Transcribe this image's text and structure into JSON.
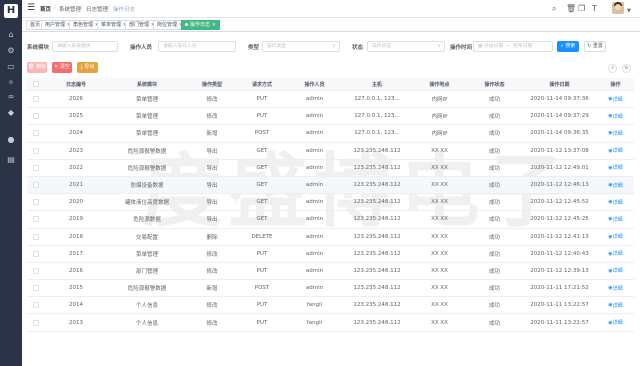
{
  "sidebar": {
    "logo": "H",
    "icons": [
      "home-icon",
      "settings-icon",
      "monitor-icon",
      "tool-icon",
      "link-icon",
      "shield-icon",
      "info-icon",
      "document-icon"
    ]
  },
  "breadcrumb": [
    "首页",
    "系统管理",
    "日志管理",
    "操作日志"
  ],
  "tags": [
    {
      "label": "首页"
    },
    {
      "label": "用户管理"
    },
    {
      "label": "角色管理"
    },
    {
      "label": "菜单管理"
    },
    {
      "label": "部门管理"
    },
    {
      "label": "岗位管理"
    },
    {
      "label": "操作日志"
    }
  ],
  "filters": {
    "module_label": "系统模块",
    "module_placeholder": "请输入系统模块",
    "operator_label": "操作人员",
    "operator_placeholder": "请输入操作人员",
    "type_label": "类型",
    "type_placeholder": "操作类型",
    "status_label": "状态",
    "status_placeholder": "操作状态",
    "time_label": "操作时间",
    "start_placeholder": "开始日期",
    "range_sep": "-",
    "end_placeholder": "结束日期",
    "search_label": "搜索",
    "reset_label": "重置"
  },
  "toolbar": {
    "delete_label": "删除",
    "clear_label": "清空",
    "export_label": "导出"
  },
  "table": {
    "headers": [
      "日志编号",
      "系统模块",
      "操作类型",
      "请求方式",
      "操作人员",
      "主机",
      "操作地点",
      "操作状态",
      "操作日期",
      "操作"
    ],
    "rows": [
      {
        "id": "2026",
        "module": "菜单管理",
        "type": "修改",
        "method": "PUT",
        "user": "admin",
        "host": "127.0.0.1, 123...",
        "location": "内网IP",
        "status": "成功",
        "date": "2020-11-14 09:37:36",
        "action": "详细"
      },
      {
        "id": "2025",
        "module": "菜单管理",
        "type": "修改",
        "method": "PUT",
        "user": "admin",
        "host": "127.0.0.1, 123...",
        "location": "内网IP",
        "status": "成功",
        "date": "2020-11-14 09:37:29",
        "action": "详细"
      },
      {
        "id": "2024",
        "module": "菜单管理",
        "type": "新增",
        "method": "POST",
        "user": "admin",
        "host": "127.0.0.1, 123...",
        "location": "内网IP",
        "status": "成功",
        "date": "2020-11-14 09:36:35",
        "action": "详细"
      },
      {
        "id": "2023",
        "module": "危险源报警数据",
        "type": "导出",
        "method": "GET",
        "user": "admin",
        "host": "123.235.248.112",
        "location": "XX XX",
        "status": "成功",
        "date": "2020-11-12 13:37:08",
        "action": "详细"
      },
      {
        "id": "2022",
        "module": "危险源报警数据",
        "type": "导出",
        "method": "GET",
        "user": "admin",
        "host": "123.235.248.112",
        "location": "XX XX",
        "status": "成功",
        "date": "2020-11-12 12:49:01",
        "action": "详细"
      },
      {
        "id": "2021",
        "module": "防爆设备数据",
        "type": "导出",
        "method": "GET",
        "user": "admin",
        "host": "123.235.248.112",
        "location": "XX XX",
        "status": "成功",
        "date": "2020-11-12 12:46:13",
        "action": "详细"
      },
      {
        "id": "2020",
        "module": "罐体液位高度数据",
        "type": "导出",
        "method": "GET",
        "user": "admin",
        "host": "123.235.248.112",
        "location": "XX XX",
        "status": "成功",
        "date": "2020-11-12 12:45:52",
        "action": "详细"
      },
      {
        "id": "2019",
        "module": "危险源数据",
        "type": "导出",
        "method": "GET",
        "user": "admin",
        "host": "123.235.248.112",
        "location": "XX XX",
        "status": "成功",
        "date": "2020-11-12 12:45:25",
        "action": "详细"
      },
      {
        "id": "2018",
        "module": "交易配置",
        "type": "删除",
        "method": "DELETE",
        "user": "admin",
        "host": "123.235.248.112",
        "location": "XX XX",
        "status": "成功",
        "date": "2020-11-12 12:41:13",
        "action": "详细"
      },
      {
        "id": "2017",
        "module": "菜单管理",
        "type": "修改",
        "method": "PUT",
        "user": "admin",
        "host": "123.235.248.112",
        "location": "XX XX",
        "status": "成功",
        "date": "2020-11-12 12:40:43",
        "action": "详细"
      },
      {
        "id": "2016",
        "module": "部门管理",
        "type": "修改",
        "method": "PUT",
        "user": "admin",
        "host": "123.235.248.112",
        "location": "XX XX",
        "status": "成功",
        "date": "2020-11-12 12:39:13",
        "action": "详细"
      },
      {
        "id": "2015",
        "module": "危险源报警数据",
        "type": "新增",
        "method": "POST",
        "user": "admin",
        "host": "123.235.248.112",
        "location": "XX XX",
        "status": "成功",
        "date": "2020-11-11 17:21:52",
        "action": "详细"
      },
      {
        "id": "2014",
        "module": "个人信息",
        "type": "修改",
        "method": "PUT",
        "user": "fangli",
        "host": "123.235.248.112",
        "location": "XX XX",
        "status": "成功",
        "date": "2020-11-11 13:22:57",
        "action": "详细"
      },
      {
        "id": "2013",
        "module": "个人信息",
        "type": "修改",
        "method": "PUT",
        "user": "fangli",
        "host": "123.235.248.112",
        "location": "XX XX",
        "status": "成功",
        "date": "2020-11-11 13:22:57",
        "action": "详细"
      }
    ]
  },
  "colors": {
    "primary": "#1890ff",
    "sidebar": "#2b3346",
    "active_tag": "#42b983",
    "danger": "#f56c6c",
    "warning": "#e6a23c"
  }
}
